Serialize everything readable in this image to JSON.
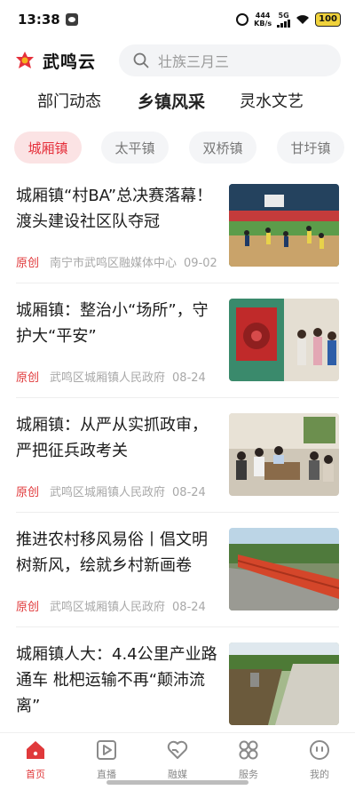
{
  "status_bar": {
    "time": "13:38",
    "net_speed_value": "444",
    "net_speed_unit": "KB/s",
    "network": "5G",
    "battery": "100"
  },
  "header": {
    "app_name": "武鸣云",
    "search_placeholder": "壮族三月三"
  },
  "category_tabs": [
    {
      "label": "部门动态",
      "active": false
    },
    {
      "label": "乡镇风采",
      "active": true
    },
    {
      "label": "灵水文艺",
      "active": false
    }
  ],
  "town_chips": [
    {
      "label": "城厢镇",
      "active": true
    },
    {
      "label": "太平镇",
      "active": false
    },
    {
      "label": "双桥镇",
      "active": false
    },
    {
      "label": "甘圩镇",
      "active": false
    }
  ],
  "news": [
    {
      "title": "城厢镇“村BA”总决赛落幕！渡头建设社区队夺冠",
      "tag": "原创",
      "source": "南宁市武鸣区融媒体中心",
      "date": "09-02",
      "thumb": "basketball-game-photo"
    },
    {
      "title": "城厢镇：整治小“场所”，守护大“平安”",
      "tag": "原创",
      "source": "武鸣区城厢镇人民政府",
      "date": "08-24",
      "thumb": "fire-hydrant-inspection-photo"
    },
    {
      "title": "城厢镇：从严从实抓政审，严把征兵政考关",
      "tag": "原创",
      "source": "武鸣区城厢镇人民政府",
      "date": "08-24",
      "thumb": "home-visit-photo"
    },
    {
      "title": "推进农村移风易俗丨倡文明树新风，绘就乡村新画卷",
      "tag": "原创",
      "source": "武鸣区城厢镇人民政府",
      "date": "08-24",
      "thumb": "red-railing-pond-photo"
    },
    {
      "title": "城厢镇人大：4.4公里产业路通车 枇杷运输不再“颠沛流离”",
      "tag": "",
      "source": "",
      "date": "",
      "thumb": "rural-road-photo"
    }
  ],
  "bottom_nav": [
    {
      "label": "首页",
      "icon": "home-icon",
      "active": true
    },
    {
      "label": "直播",
      "icon": "play-icon",
      "active": false
    },
    {
      "label": "融媒",
      "icon": "heart-handshake-icon",
      "active": false
    },
    {
      "label": "服务",
      "icon": "grid-clover-icon",
      "active": false
    },
    {
      "label": "我的",
      "icon": "smiley-icon",
      "active": false
    }
  ],
  "colors": {
    "accent": "#e0393b",
    "chip_active_bg": "#fbe3e4",
    "search_bg": "#f3f4f6"
  }
}
